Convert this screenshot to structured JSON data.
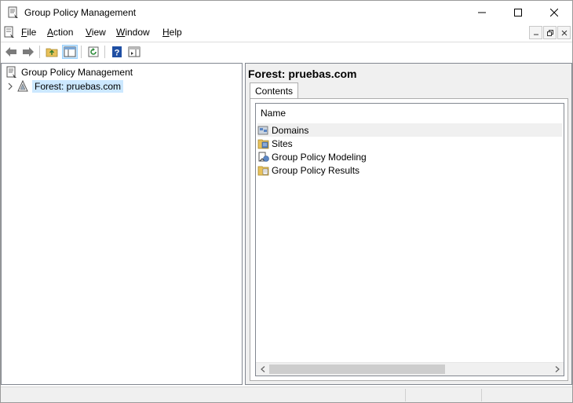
{
  "window": {
    "title": "Group Policy Management"
  },
  "menu": {
    "items": [
      {
        "label_u": "F",
        "label_rest": "ile"
      },
      {
        "label_u": "A",
        "label_rest": "ction"
      },
      {
        "label_u": "V",
        "label_rest": "iew"
      },
      {
        "label_u": "W",
        "label_rest": "indow"
      },
      {
        "label_u": "H",
        "label_rest": "elp"
      }
    ]
  },
  "tree": {
    "root": "Group Policy Management",
    "forest": "Forest: pruebas.com"
  },
  "details": {
    "heading": "Forest: pruebas.com",
    "tab": "Contents",
    "column_name": "Name",
    "rows": [
      {
        "label": "Domains",
        "icon": "domains-icon"
      },
      {
        "label": "Sites",
        "icon": "sites-icon"
      },
      {
        "label": "Group Policy Modeling",
        "icon": "modeling-icon"
      },
      {
        "label": "Group Policy Results",
        "icon": "results-icon"
      }
    ]
  },
  "colors": {
    "selection": "#cce8ff",
    "folder": "#e8c15a",
    "help_blue": "#1f4fa3",
    "refresh_green": "#2e8b3a"
  }
}
